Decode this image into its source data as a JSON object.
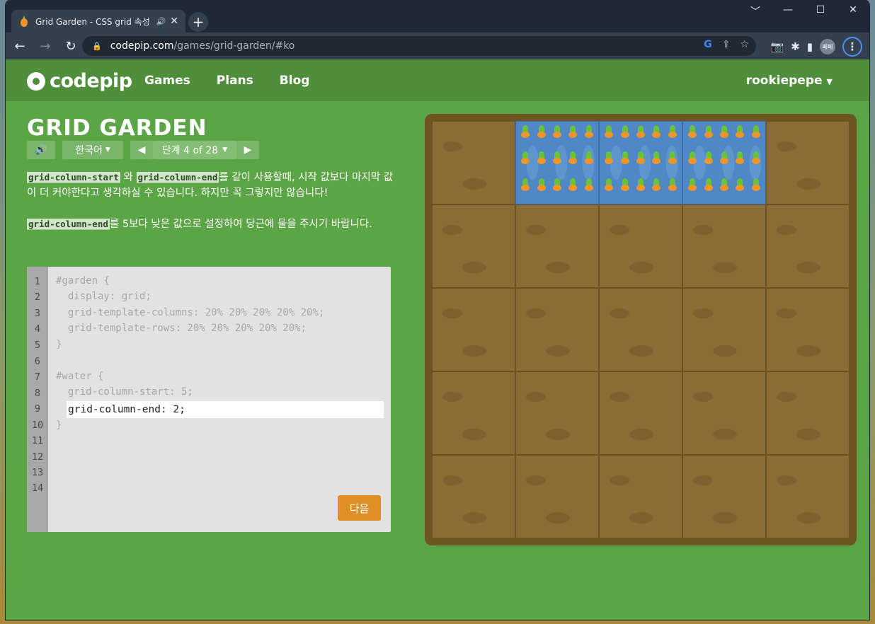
{
  "browser": {
    "tab_title": "Grid Garden - CSS grid 속성",
    "new_tab_label": "+",
    "url_host": "codepip.com",
    "url_path": "/games/grid-garden/#ko",
    "profile_label": "페페"
  },
  "site": {
    "logo_text": "codepip",
    "nav": [
      "Games",
      "Plans",
      "Blog"
    ],
    "user": "rookiepepe"
  },
  "game": {
    "title": "GRID GARDEN",
    "language": "한국어",
    "level_label": "단계 4 of 28",
    "instructions": {
      "p1_code1": "grid-column-start",
      "p1_mid": " 와 ",
      "p1_code2": "grid-column-end",
      "p1_rest": "를 같이 사용할때, 시작 값보다 마지막 값이 더 커야한다고 생각하실 수 있습니다. 하지만 꼭 그렇지만 않습니다!",
      "p2_code": "grid-column-end",
      "p2_rest": "를 5보다 낮은 값으로 설정하여 당근에 물을 주시기 바랍니다."
    },
    "editor": {
      "line_numbers": [
        "1",
        "2",
        "3",
        "4",
        "5",
        "6",
        "7",
        "8",
        "9",
        "10",
        "11",
        "12",
        "13",
        "14"
      ],
      "lines": [
        "#garden {",
        "  display: grid;",
        "  grid-template-columns: 20% 20% 20% 20% 20%;",
        "  grid-template-rows: 20% 20% 20% 20% 20%;",
        "}",
        "",
        "#water {",
        "  grid-column-start: 5;",
        "",
        "}"
      ],
      "input_value": "grid-column-end: 2;",
      "next_label": "다음"
    },
    "garden": {
      "columns": 5,
      "rows": 5,
      "water_cells": [
        [
          1,
          2
        ],
        [
          1,
          3
        ],
        [
          1,
          4
        ]
      ],
      "colors": {
        "dirt": "#8a6c34",
        "water": "#4f88c4",
        "border": "#6d5522"
      }
    }
  }
}
